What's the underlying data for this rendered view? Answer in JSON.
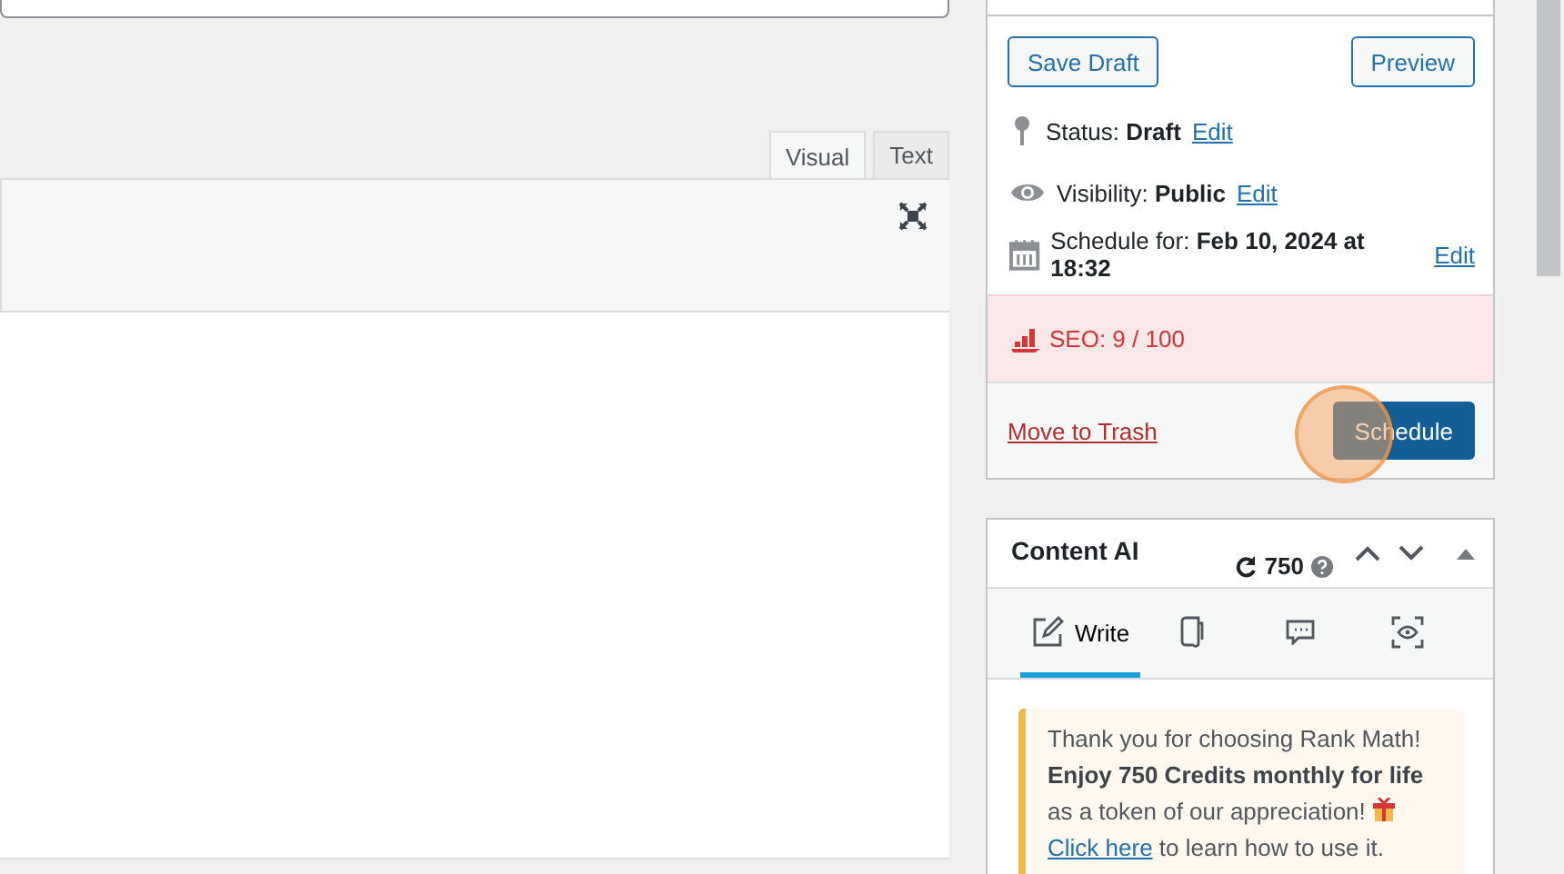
{
  "editor": {
    "tabs": [
      {
        "label": "Visual",
        "selected": true
      },
      {
        "label": "Text",
        "selected": false
      }
    ]
  },
  "publish": {
    "save_draft": "Save Draft",
    "preview": "Preview",
    "meta": [
      {
        "kind": "status",
        "label": "Status:",
        "value": "Draft",
        "link": "Edit"
      },
      {
        "kind": "visibility",
        "label": "Visibility:",
        "value": "Public",
        "link": "Edit"
      },
      {
        "kind": "schedule",
        "label": "Schedule for:",
        "value": "Feb 10, 2024 at 18:32",
        "link": "Edit"
      }
    ],
    "seo": "SEO: 9 / 100",
    "trash": "Move to Trash",
    "primary": "Schedule"
  },
  "content_ai": {
    "title": "Content AI",
    "credits": "750",
    "tabs": [
      {
        "kind": "write",
        "label": "Write",
        "selected": true
      },
      {
        "kind": "document",
        "selected": false
      },
      {
        "kind": "chat",
        "selected": false
      },
      {
        "kind": "preview",
        "selected": false
      }
    ],
    "notice": {
      "text": "Thank you for choosing Rank Math! **Enjoy 750 Credits monthly for life** as a token of our appreciation!",
      "link": "Click here",
      "after": " to learn how to use it."
    }
  }
}
